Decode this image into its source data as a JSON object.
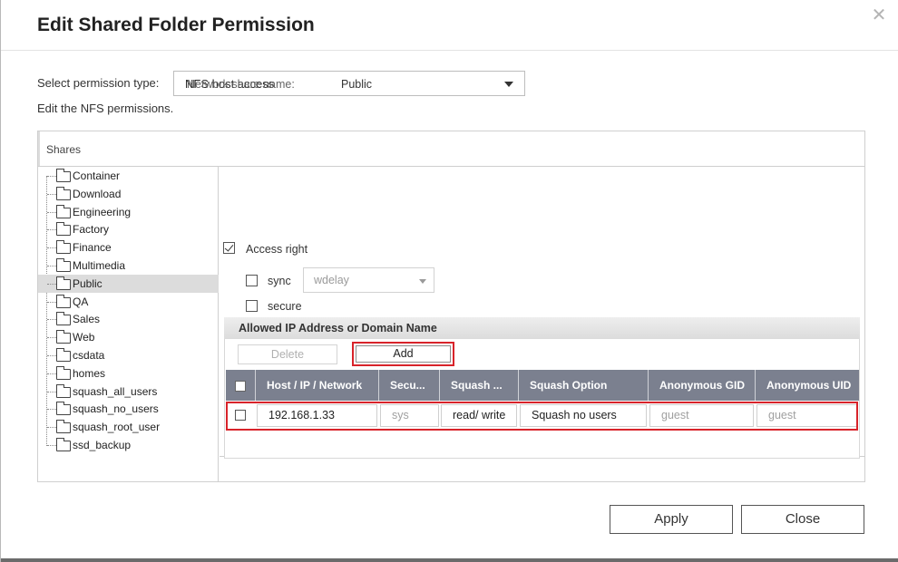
{
  "dialog": {
    "title": "Edit Shared Folder Permission",
    "close_glyph": "✕"
  },
  "permission": {
    "label": "Select permission type:",
    "selected": "NFS host access",
    "description": "Edit the NFS permissions."
  },
  "shares": {
    "header": "Shares",
    "selected": "Public",
    "items": [
      "Container",
      "Download",
      "Engineering",
      "Factory",
      "Finance",
      "Multimedia",
      "Public",
      "QA",
      "Sales",
      "Web",
      "csdata",
      "homes",
      "squash_all_users",
      "squash_no_users",
      "squash_root_user",
      "ssd_backup"
    ]
  },
  "detail": {
    "network_share_label": "Network share name:",
    "network_share_value": "Public",
    "access_right_label": "Access right",
    "access_right_checked": true,
    "sync_label": "sync",
    "sync_checked": false,
    "sync_mode": "wdelay",
    "secure_label": "secure",
    "secure_checked": false
  },
  "allowed": {
    "header": "Allowed IP Address or Domain Name",
    "delete_label": "Delete",
    "add_label": "Add",
    "columns": [
      "Host / IP / Network",
      "Secu...",
      "Squash ...",
      "Squash Option",
      "Anonymous GID",
      "Anonymous UID"
    ],
    "rows": [
      {
        "host": "192.168.1.33",
        "security": "sys",
        "permission": "read/ write",
        "squash_option": "Squash no users",
        "anon_gid": "guest",
        "anon_uid": "guest"
      }
    ]
  },
  "footer": {
    "apply_label": "Apply",
    "close_label": "Close"
  },
  "colors": {
    "highlight": "#d8232a",
    "grid_header": "#7b808f",
    "selected_row": "#dcdcdc"
  }
}
